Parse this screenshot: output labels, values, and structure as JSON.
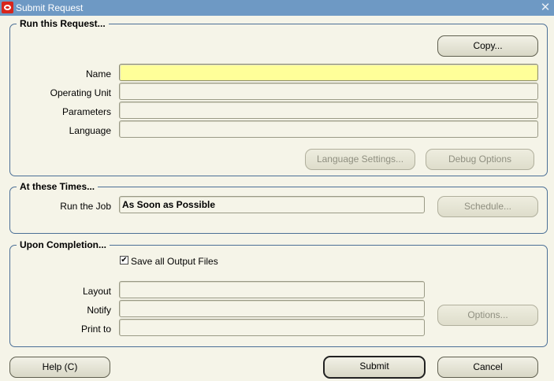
{
  "window": {
    "title": "Submit Request",
    "close_glyph": "✕"
  },
  "run_request": {
    "title": "Run this Request...",
    "copy_button": "Copy...",
    "fields": {
      "name": {
        "label": "Name",
        "value": ""
      },
      "operating_unit": {
        "label": "Operating Unit",
        "value": ""
      },
      "parameters": {
        "label": "Parameters",
        "value": ""
      },
      "language": {
        "label": "Language",
        "value": ""
      }
    },
    "language_settings_button": "Language Settings...",
    "debug_options_button": "Debug Options"
  },
  "times": {
    "title": "At these Times...",
    "run_job_label": "Run the Job",
    "run_job_value": "As Soon as Possible",
    "schedule_button": "Schedule..."
  },
  "completion": {
    "title": "Upon Completion...",
    "save_output_label": "Save all Output Files",
    "save_output_checked": "✔",
    "fields": {
      "layout": {
        "label": "Layout",
        "value": ""
      },
      "notify": {
        "label": "Notify",
        "value": ""
      },
      "print_to": {
        "label": "Print to",
        "value": ""
      }
    },
    "options_button": "Options..."
  },
  "footer": {
    "help_button": "Help (C)",
    "submit_button": "Submit",
    "cancel_button": "Cancel"
  },
  "colors": {
    "titlebar": "#6e99c4",
    "background": "#f5f4e8",
    "active_field": "#ffff99",
    "group_border": "#4b6f96"
  }
}
